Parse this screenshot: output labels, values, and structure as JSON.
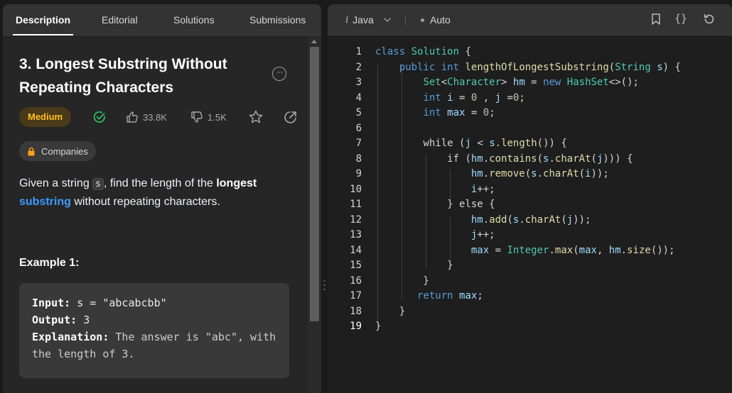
{
  "tabs": [
    {
      "label": "Description"
    },
    {
      "label": "Editorial"
    },
    {
      "label": "Solutions"
    },
    {
      "label": "Submissions"
    }
  ],
  "problem": {
    "title": "3. Longest Substring Without Repeating Characters",
    "difficulty": "Medium",
    "likes": "33.8K",
    "dislikes": "1.5K",
    "companies_label": "Companies",
    "desc_1": "Given a string ",
    "desc_code": "s",
    "desc_2": ", find the length of the ",
    "desc_bold": "longest",
    "desc_link": "substring",
    "desc_3": " without repeating characters."
  },
  "example": {
    "title": "Example 1:",
    "input_label": "Input:",
    "input_value": "s = \"abcabcbb\"",
    "output_label": "Output:",
    "output_value": "3",
    "explanation_label": "Explanation:",
    "explanation_value": "The answer is \"abc\", with the length of 3."
  },
  "editor": {
    "language": "Java",
    "mode": "Auto",
    "current_line": 19,
    "lines": [
      "class Solution {",
      "    public int lengthOfLongestSubstring(String s) {",
      "        Set<Character> hm = new HashSet<>();",
      "        int i = 0 , j =0;",
      "        int max = 0;",
      "",
      "        while (j < s.length()) {",
      "            if (hm.contains(s.charAt(j))) {",
      "                hm.remove(s.charAt(i));",
      "                i++;",
      "            } else {",
      "                hm.add(s.charAt(j));",
      "                j++;",
      "                max = Integer.max(max, hm.size());",
      "            }",
      "        }",
      "       return max;",
      "    }",
      "}"
    ]
  },
  "colors": {
    "medium": "#ffc01e",
    "link": "#3b9cff",
    "solved": "#2cbb5d"
  }
}
